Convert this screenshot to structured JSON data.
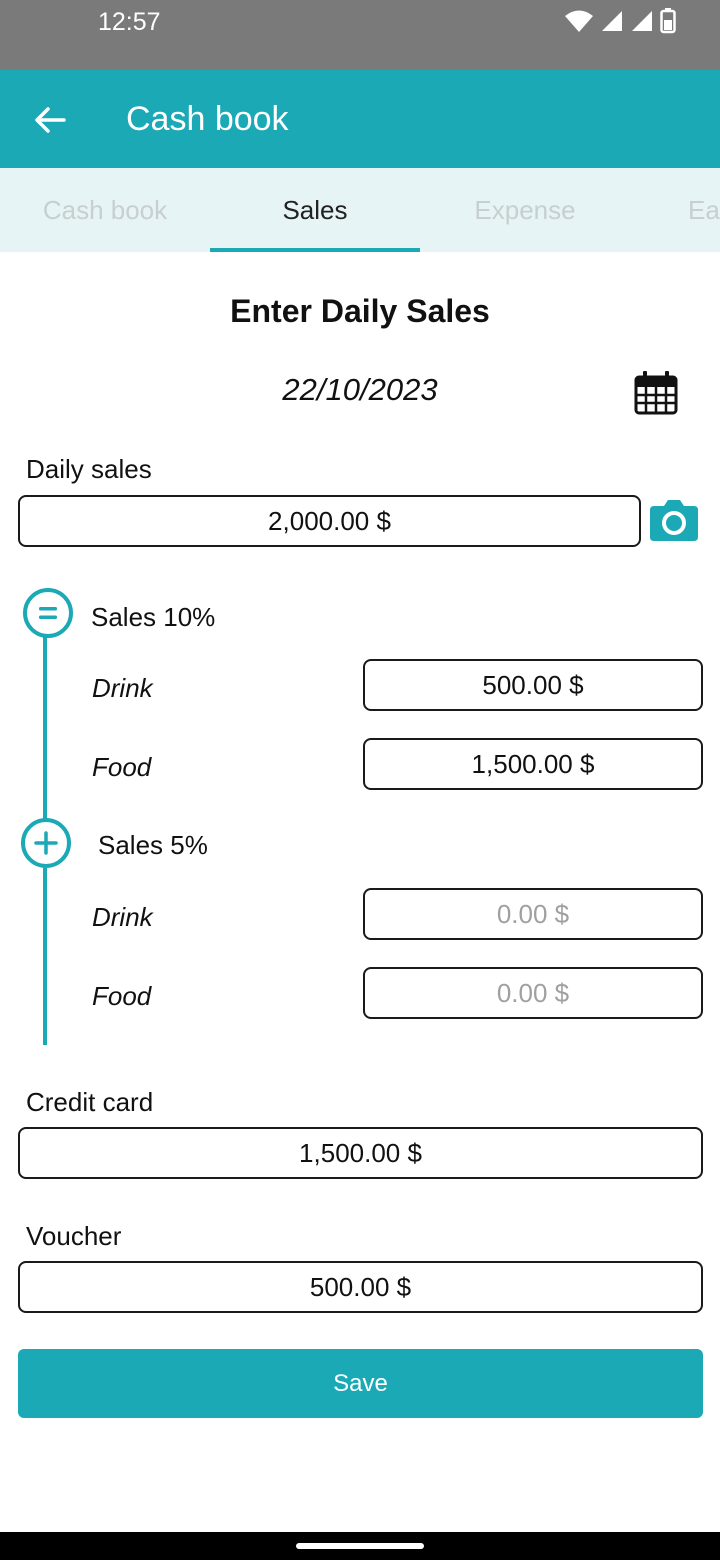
{
  "status_bar": {
    "time": "12:57"
  },
  "app_bar": {
    "title": "Cash book"
  },
  "tabs": [
    {
      "label": "Cash book"
    },
    {
      "label": "Sales"
    },
    {
      "label": "Expense"
    },
    {
      "label": "Ea"
    }
  ],
  "form": {
    "heading": "Enter Daily Sales",
    "date": "22/10/2023",
    "daily_sales": {
      "label": "Daily sales",
      "value": "2,000.00 $"
    },
    "sales_10": {
      "title": "Sales 10%",
      "drink": {
        "label": "Drink",
        "value": "500.00 $"
      },
      "food": {
        "label": "Food",
        "value": "1,500.00 $"
      }
    },
    "sales_5": {
      "title": "Sales 5%",
      "drink": {
        "label": "Drink",
        "placeholder": "0.00 $"
      },
      "food": {
        "label": "Food",
        "placeholder": "0.00 $"
      }
    },
    "credit_card": {
      "label": "Credit card",
      "value": "1,500.00 $"
    },
    "voucher": {
      "label": "Voucher",
      "value": "500.00 $"
    },
    "save_label": "Save"
  },
  "colors": {
    "accent": "#1ba9b6",
    "status_bar": "#7a7a7a",
    "tab_bg": "#e7f4f5"
  }
}
